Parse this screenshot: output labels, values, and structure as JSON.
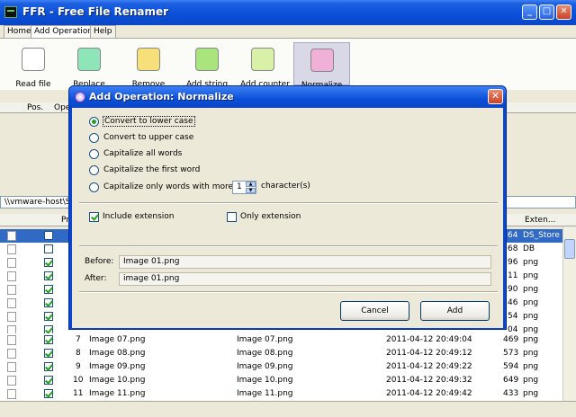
{
  "window": {
    "title": "FFR - Free File Renamer",
    "min": "_",
    "max": "□",
    "close": "✕"
  },
  "menu": {
    "tabs": [
      "Home",
      "Add Operation",
      "Help"
    ]
  },
  "ribbon": {
    "tools": [
      {
        "label": "Read file",
        "color": "#ffffff",
        "icon_label": "word"
      },
      {
        "label": "Replace",
        "color": "#8ee6b8",
        "icon_label": "word"
      },
      {
        "label": "Remove",
        "color": "#f7e07a",
        "icon_label": "word"
      },
      {
        "label": "Add string",
        "color": "#a9e47c",
        "icon_label": "word"
      },
      {
        "label": "Add counter",
        "color": "#d8f0a8",
        "icon_label": "word"
      },
      {
        "label": "Normalize",
        "color": "#f0b0d8",
        "icon_label": "WORD"
      }
    ]
  },
  "operations": {
    "col_pos": "Pos.",
    "col_op": "Ope"
  },
  "path": "\\\\vmware-host\\Sh",
  "files": {
    "header": {
      "preview": "Pr",
      "extension": "Exten..."
    },
    "partial_rows": [
      {
        "ext_num": "64",
        "ext": "DS_Store",
        "checked": false,
        "selected": true
      },
      {
        "ext_num": "68",
        "ext": "DB",
        "checked": false
      },
      {
        "ext_num": "96",
        "ext": "png",
        "checked": true
      },
      {
        "ext_num": "11",
        "ext": "png",
        "checked": true
      },
      {
        "ext_num": "90",
        "ext": "png",
        "checked": true
      },
      {
        "ext_num": "46",
        "ext": "png",
        "checked": true
      },
      {
        "ext_num": "54",
        "ext": "png",
        "checked": true
      },
      {
        "ext_num": "04",
        "ext": "png",
        "checked": true
      }
    ],
    "rows": [
      {
        "pos": "7",
        "name": "Image 07.png",
        "new_name": "Image 07.png",
        "date": "2011-04-12 20:49:04",
        "size": "469",
        "ext": "png",
        "checked": true
      },
      {
        "pos": "8",
        "name": "Image 08.png",
        "new_name": "Image 08.png",
        "date": "2011-04-12 20:49:12",
        "size": "573",
        "ext": "png",
        "checked": true
      },
      {
        "pos": "9",
        "name": "Image 09.png",
        "new_name": "Image 09.png",
        "date": "2011-04-12 20:49:22",
        "size": "594",
        "ext": "png",
        "checked": true
      },
      {
        "pos": "10",
        "name": "Image 10.png",
        "new_name": "Image 10.png",
        "date": "2011-04-12 20:49:32",
        "size": "649",
        "ext": "png",
        "checked": true
      },
      {
        "pos": "11",
        "name": "Image 11.png",
        "new_name": "Image 11.png",
        "date": "2011-04-12 20:49:42",
        "size": "433",
        "ext": "png",
        "checked": true
      }
    ]
  },
  "dialog": {
    "title": "Add Operation: Normalize",
    "close": "✕",
    "options": [
      {
        "label": "Convert to lower case",
        "selected": true
      },
      {
        "label": "Convert to upper case",
        "selected": false
      },
      {
        "label": "Capitalize all words",
        "selected": false
      },
      {
        "label": "Capitalize the first word",
        "selected": false
      },
      {
        "label": "Capitalize only words with more than",
        "selected": false
      }
    ],
    "min_chars": "1",
    "min_chars_suffix": "character(s)",
    "include_extension": {
      "label": "Include extension",
      "checked": true
    },
    "only_extension": {
      "label": "Only extension",
      "checked": false
    },
    "before_label": "Before:",
    "before_value": "Image 01.png",
    "after_label": "After:",
    "after_value": "image 01.png",
    "cancel_label": "Cancel",
    "add_label": "Add"
  }
}
